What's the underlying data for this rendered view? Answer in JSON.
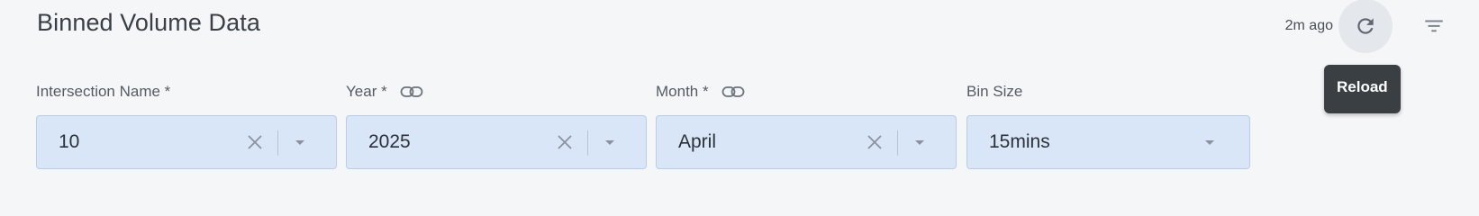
{
  "header": {
    "title": "Binned Volume Data",
    "updated": "2m ago"
  },
  "actions": {
    "reload_tooltip": "Reload"
  },
  "filters": {
    "intersection": {
      "label": "Intersection Name *",
      "value": "10"
    },
    "year": {
      "label": "Year *",
      "value": "2025"
    },
    "month": {
      "label": "Month *",
      "value": "April"
    },
    "bin_size": {
      "label": "Bin Size",
      "value": "15mins"
    }
  },
  "icons": {
    "reload": "reload-icon",
    "filter": "filter-icon",
    "link": "link-icon",
    "clear": "close-icon",
    "dropdown": "caret-down-icon"
  },
  "colors": {
    "field_background": "#d9e6f8",
    "field_border": "#b9cde8",
    "tooltip_background": "#3a3f44",
    "page_background": "#f5f6f8"
  }
}
